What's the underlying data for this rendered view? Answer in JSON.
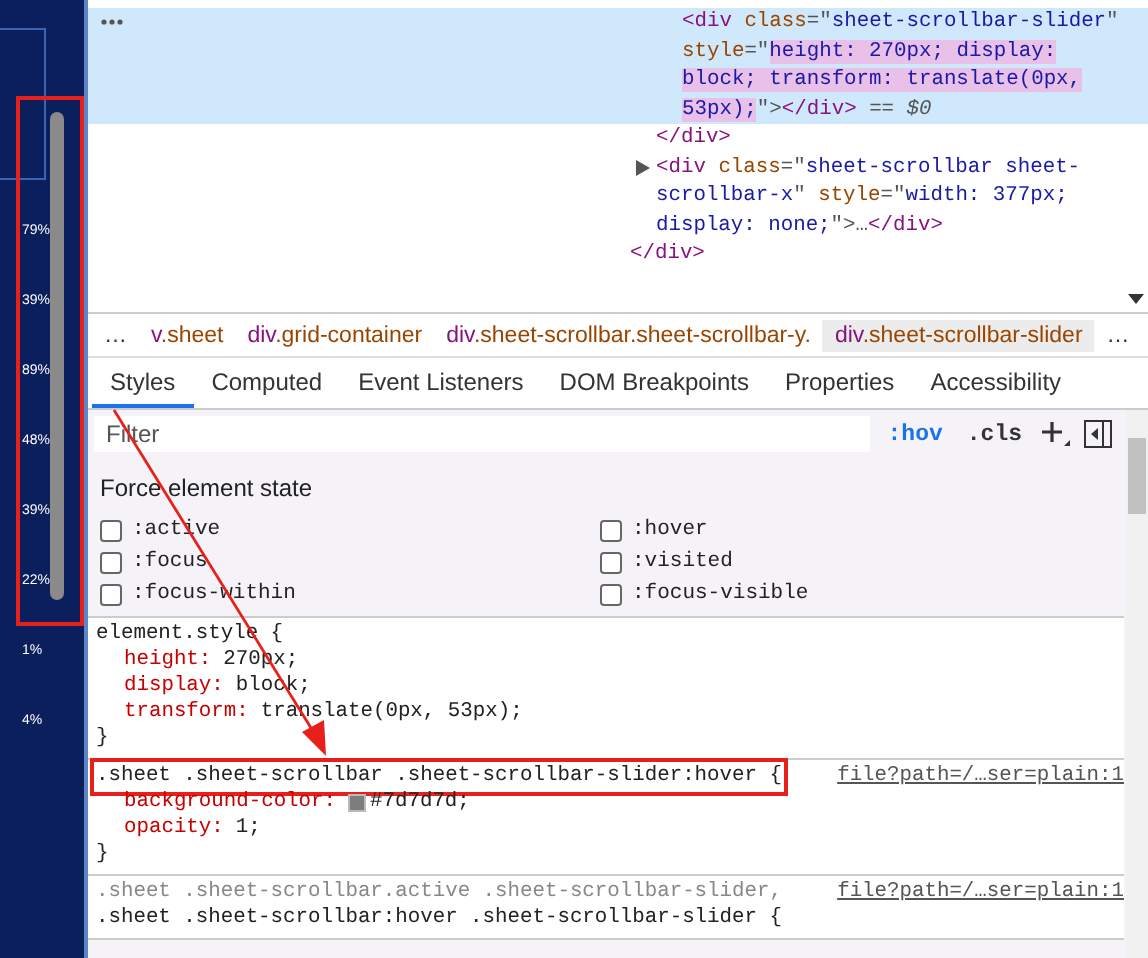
{
  "left_panel": {
    "labels": [
      "79%",
      "39%",
      "89%",
      "48%",
      "39%",
      "22%",
      "1%",
      "4%"
    ]
  },
  "elements": {
    "tree": [
      {
        "children": [
          {
            "close": "</div>",
            "children": [
              {
                "close": "</div>",
                "children": [
                  {
                    "selected": true,
                    "segments": [
                      {
                        "kind": "tag",
                        "text": "<div"
                      },
                      {
                        "kind": "attr",
                        "text": " class"
                      },
                      {
                        "kind": "punct",
                        "text": "=\""
                      },
                      {
                        "kind": "value",
                        "text": "sheet-scrollbar-slider"
                      },
                      {
                        "kind": "punct",
                        "text": "\""
                      },
                      {
                        "kind": "attr",
                        "text": " style"
                      },
                      {
                        "kind": "punct",
                        "text": "=\""
                      },
                      {
                        "kind": "value",
                        "text": "height: 270px; display: block; transform: translate(0px, 53px);",
                        "highlighted": true
                      },
                      {
                        "kind": "punct",
                        "text": "\">"
                      },
                      {
                        "kind": "tag",
                        "text": "</div>"
                      },
                      {
                        "kind": "marker",
                        "text": " == $0"
                      }
                    ]
                  }
                ]
              },
              {
                "selected": false,
                "expanded": false,
                "segments": [
                  {
                    "kind": "tag",
                    "text": "<div"
                  },
                  {
                    "kind": "attr",
                    "text": " class"
                  },
                  {
                    "kind": "punct",
                    "text": "=\""
                  },
                  {
                    "kind": "value",
                    "text": "sheet-scrollbar sheet-scrollbar-x"
                  },
                  {
                    "kind": "punct",
                    "text": "\""
                  },
                  {
                    "kind": "attr",
                    "text": " style"
                  },
                  {
                    "kind": "punct",
                    "text": "=\""
                  },
                  {
                    "kind": "value",
                    "text": "width: 377px; display: none;",
                    "highlighted": false
                  },
                  {
                    "kind": "punct",
                    "text": "\">…"
                  },
                  {
                    "kind": "tag",
                    "text": "</div>"
                  }
                ]
              }
            ]
          }
        ]
      }
    ]
  },
  "breadcrumbs": [
    {
      "text": "…",
      "selected": false
    },
    {
      "tag": "v",
      "cls": ".sheet",
      "selected": false
    },
    {
      "tag": "div",
      "cls": ".grid-container",
      "selected": false
    },
    {
      "tag": "div",
      "cls": ".sheet-scrollbar.sheet-scrollbar-y.",
      "selected": false
    },
    {
      "tag": "div",
      "cls": ".sheet-scrollbar-slider",
      "selected": true
    },
    {
      "text": "…",
      "selected": false
    }
  ],
  "tabs": [
    {
      "label": "Styles",
      "selected": true
    },
    {
      "label": "Computed",
      "selected": false
    },
    {
      "label": "Event Listeners",
      "selected": false
    },
    {
      "label": "DOM Breakpoints",
      "selected": false
    },
    {
      "label": "Properties",
      "selected": false
    },
    {
      "label": "Accessibility",
      "selected": false
    }
  ],
  "filter": {
    "placeholder": "Filter",
    "hov": ":hov",
    "cls": ".cls"
  },
  "force_state": {
    "title": "Force element state",
    "states": [
      {
        "label": ":active",
        "checked": false
      },
      {
        "label": ":hover",
        "checked": false
      },
      {
        "label": ":focus",
        "checked": false
      },
      {
        "label": ":visited",
        "checked": false
      },
      {
        "label": ":focus-within",
        "checked": false
      },
      {
        "label": ":focus-visible",
        "checked": false
      }
    ]
  },
  "rules": [
    {
      "selectors": [
        {
          "text": "element.style {",
          "matched": true
        }
      ],
      "boxed": false,
      "properties": [
        {
          "name": "height:",
          "value": "270px;"
        },
        {
          "name": "display:",
          "value": "block;"
        },
        {
          "name": "transform:",
          "value": "translate(0px, 53px);"
        }
      ],
      "close": "}"
    },
    {
      "selectors": [
        {
          "text": ".sheet .sheet-scrollbar .sheet-scrollbar-slider:hover {",
          "matched": true
        }
      ],
      "boxed": true,
      "source": "file?path=/…ser=plain:1",
      "properties": [
        {
          "name": "background-color:",
          "value": "#7d7d7d;",
          "swatch": true
        },
        {
          "name": "opacity:",
          "value": "1;"
        }
      ],
      "close": "}"
    },
    {
      "selectors": [
        {
          "text": ".sheet .sheet-scrollbar.active .sheet-scrollbar-slider,",
          "matched": false
        },
        {
          "text": ".sheet .sheet-scrollbar:hover .sheet-scrollbar-slider {",
          "matched": true
        }
      ],
      "boxed": false,
      "source": "file?path=/…ser=plain:1"
    }
  ]
}
